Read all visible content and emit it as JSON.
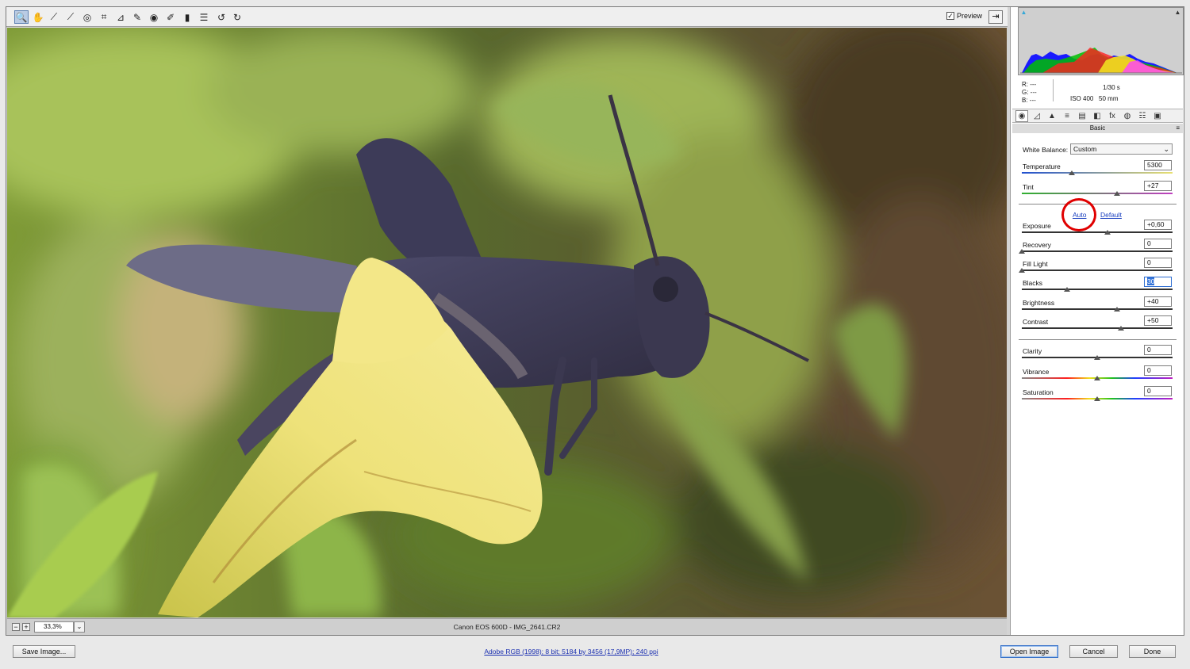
{
  "toolbar": {
    "tools": [
      {
        "name": "zoom-tool",
        "icon": "magnifier-icon",
        "glyph": "🔍"
      },
      {
        "name": "hand-tool",
        "icon": "hand-icon",
        "glyph": "✋"
      },
      {
        "name": "white-balance-tool",
        "icon": "eyedropper-icon",
        "glyph": "⟋"
      },
      {
        "name": "color-sampler-tool",
        "icon": "color-sampler-icon",
        "glyph": "⟋"
      },
      {
        "name": "targeted-adjustment-tool",
        "icon": "target-icon",
        "glyph": "◎"
      },
      {
        "name": "crop-tool",
        "icon": "crop-icon",
        "glyph": "⌗"
      },
      {
        "name": "straighten-tool",
        "icon": "straighten-icon",
        "glyph": "⊿"
      },
      {
        "name": "spot-removal-tool",
        "icon": "spot-removal-icon",
        "glyph": "✎"
      },
      {
        "name": "red-eye-tool",
        "icon": "red-eye-icon",
        "glyph": "◉"
      },
      {
        "name": "adjustment-brush-tool",
        "icon": "brush-icon",
        "glyph": "✐"
      },
      {
        "name": "graduated-filter-tool",
        "icon": "graduated-filter-icon",
        "glyph": "▮"
      },
      {
        "name": "preferences-tool",
        "icon": "list-icon",
        "glyph": "☰"
      },
      {
        "name": "rotate-left-tool",
        "icon": "rotate-left-icon",
        "glyph": "↺"
      },
      {
        "name": "rotate-right-tool",
        "icon": "rotate-right-icon",
        "glyph": "↻"
      }
    ],
    "preview_label": "Preview",
    "preview_checked": "✓",
    "fullscreen_glyph": "⇥"
  },
  "image_status": {
    "zoom_minus": "−",
    "zoom_plus": "+",
    "zoom_value": "33,3%",
    "zoom_dropdown": "⌄",
    "file_label": "Canon EOS 600D  -  IMG_2641.CR2"
  },
  "readout": {
    "r": "R:   ---",
    "g": "G:   ---",
    "b": "B:   ---",
    "shutter": "1/30 s",
    "iso": "ISO 400",
    "focal": "50 mm"
  },
  "panel": {
    "title": "Basic",
    "menu_glyph": "≡",
    "tabs": [
      "◉",
      "◿",
      "▲",
      "≡",
      "▤",
      "◧",
      "fx",
      "◍",
      "☷",
      "▣"
    ],
    "white_balance_label": "White Balance:",
    "white_balance_value": "Custom",
    "auto_label": "Auto",
    "default_label": "Default"
  },
  "sliders": [
    {
      "label": "Temperature",
      "value": "5300",
      "position": 0.33,
      "track": "temperature"
    },
    {
      "label": "Tint",
      "value": "+27",
      "position": 0.63,
      "track": "tint"
    },
    {
      "label": "Exposure",
      "value": "+0,60",
      "position": 0.57,
      "track": "gray"
    },
    {
      "label": "Recovery",
      "value": "0",
      "position": 0.0,
      "track": "gray"
    },
    {
      "label": "Fill Light",
      "value": "0",
      "position": 0.0,
      "track": "gray"
    },
    {
      "label": "Blacks",
      "value": "30",
      "position": 0.3,
      "track": "gray"
    },
    {
      "label": "Brightness",
      "value": "+40",
      "position": 0.63,
      "track": "gray"
    },
    {
      "label": "Contrast",
      "value": "+50",
      "position": 0.66,
      "track": "gray"
    },
    {
      "label": "Clarity",
      "value": "0",
      "position": 0.5,
      "track": "gray"
    },
    {
      "label": "Vibrance",
      "value": "0",
      "position": 0.5,
      "track": "spectrum"
    },
    {
      "label": "Saturation",
      "value": "0",
      "position": 0.5,
      "track": "spectrum"
    }
  ],
  "bottom": {
    "save_label": "Save Image...",
    "workflow_label": "Adobe RGB (1998); 8 bit; 5184 by 3456 (17,9MP); 240 ppi",
    "open_label": "Open Image",
    "cancel_label": "Cancel",
    "done_label": "Done"
  },
  "colors": {
    "accent_circle": "#e00000",
    "link": "#1a40c0",
    "selection": "#3373d9"
  }
}
